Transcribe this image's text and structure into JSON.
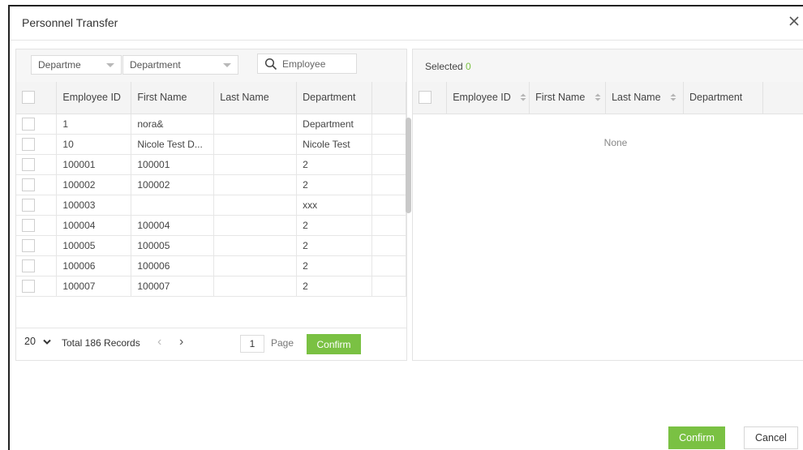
{
  "dialog": {
    "title": "Personnel Transfer"
  },
  "filters": {
    "type_select": "Departme",
    "department_select": "Department",
    "search_placeholder": "Employee"
  },
  "employees": {
    "columns": [
      "Employee ID",
      "First Name",
      "Last Name",
      "Department"
    ],
    "rows": [
      {
        "id": "1",
        "first": "nora&",
        "last": "",
        "dept": "Department"
      },
      {
        "id": "10",
        "first": "Nicole Test D...",
        "last": "",
        "dept": "Nicole Test"
      },
      {
        "id": "100001",
        "first": "100001",
        "last": "",
        "dept": "2"
      },
      {
        "id": "100002",
        "first": "100002",
        "last": "",
        "dept": "2"
      },
      {
        "id": "100003",
        "first": "",
        "last": "",
        "dept": "xxx"
      },
      {
        "id": "100004",
        "first": "100004",
        "last": "",
        "dept": "2"
      },
      {
        "id": "100005",
        "first": "100005",
        "last": "",
        "dept": "2"
      },
      {
        "id": "100006",
        "first": "100006",
        "last": "",
        "dept": "2"
      },
      {
        "id": "100007",
        "first": "100007",
        "last": "",
        "dept": "2"
      }
    ]
  },
  "pager": {
    "page_size": "20",
    "total_text": "Total 186 Records",
    "page_value": "1",
    "page_label": "Page",
    "confirm_label": "Confirm"
  },
  "selected": {
    "label": "Selected",
    "count": "0",
    "columns": [
      "Employee ID",
      "First Name",
      "Last Name",
      "Department"
    ],
    "empty_text": "None"
  },
  "footer": {
    "confirm_label": "Confirm",
    "cancel_label": "Cancel"
  },
  "colors": {
    "accent": "#7ac143"
  }
}
